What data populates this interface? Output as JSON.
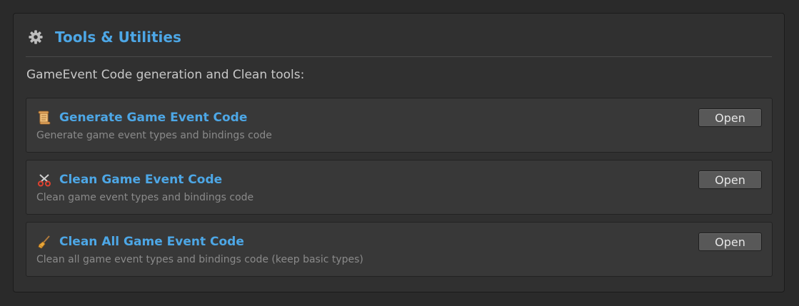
{
  "panel": {
    "title": "Tools & Utilities",
    "title_icon": "gear-icon",
    "description": "GameEvent Code generation and Clean tools:"
  },
  "tools": [
    {
      "icon": "scroll-icon",
      "name": "Generate Game Event Code",
      "subtitle": "Generate game event types and bindings code",
      "button_label": "Open"
    },
    {
      "icon": "scissors-icon",
      "name": "Clean Game Event Code",
      "subtitle": "Clean game event types and bindings code",
      "button_label": "Open"
    },
    {
      "icon": "broom-icon",
      "name": "Clean All Game Event Code",
      "subtitle": "Clean all game event types and bindings code (keep basic types)",
      "button_label": "Open"
    }
  ],
  "colors": {
    "accent": "#4da7e6",
    "background": "#2a2a2a",
    "panel": "#303030",
    "card": "#383838",
    "button": "#585858"
  }
}
